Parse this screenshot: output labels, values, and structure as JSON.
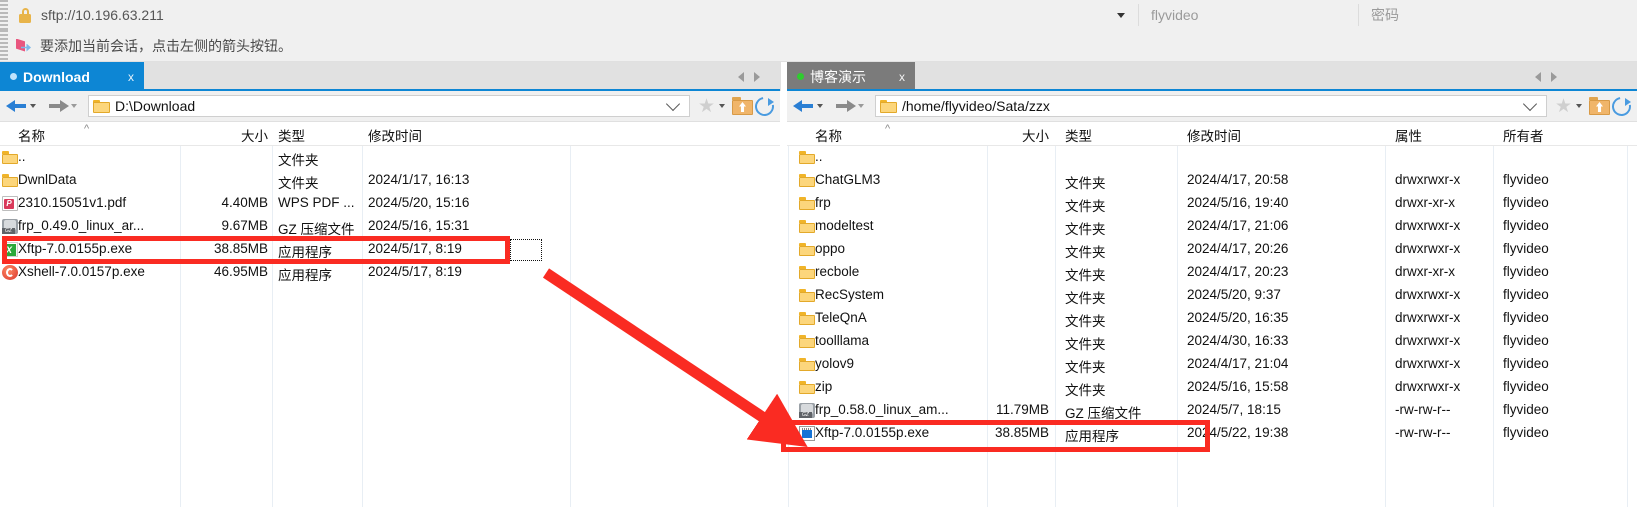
{
  "topbar": {
    "lock_icon": "lock-icon",
    "address": "sftp://10.196.63.211",
    "dropdown_icon": "chevron-down-icon",
    "username": "flyvideo",
    "password_placeholder": "密码"
  },
  "notice": {
    "icon": "flag-arrow-icon",
    "text": "要添加当前会话，点击左侧的箭头按钮。"
  },
  "tabs": {
    "left": {
      "label": "Download",
      "close_label": "x",
      "status_dot": "#bfe3fb"
    },
    "right": {
      "label": "博客演示",
      "close_label": "x",
      "status_dot": "#2ecc2e"
    },
    "nav_prev_icon": "chevron-left-icon",
    "nav_next_icon": "chevron-right-icon"
  },
  "left_pane": {
    "back_icon": "back-arrow-icon",
    "forward_icon": "forward-arrow-icon",
    "path": "D:\\Download",
    "path_dropdown_icon": "chevron-down-icon",
    "star_icon": "star-icon",
    "star_dropdown_icon": "chevron-down-icon",
    "up_folder_icon": "up-folder-icon",
    "refresh_icon": "refresh-icon",
    "columns": [
      "名称",
      "大小",
      "类型",
      "修改时间"
    ],
    "sort_indicator": "^",
    "rows": [
      {
        "icon": "folder-icon",
        "name": "..",
        "size": "",
        "type": "文件夹",
        "modified": ""
      },
      {
        "icon": "folder-icon",
        "name": "DwnlData",
        "size": "",
        "type": "文件夹",
        "modified": "2024/1/17, 16:13"
      },
      {
        "icon": "pdf-icon",
        "name": "2310.15051v1.pdf",
        "size": "4.40MB",
        "type": "WPS PDF ...",
        "modified": "2024/5/20, 15:16"
      },
      {
        "icon": "gz-icon",
        "name": "frp_0.49.0_linux_ar...",
        "size": "9.67MB",
        "type": "GZ 压缩文件",
        "modified": "2024/5/16, 15:31"
      },
      {
        "icon": "xftp-icon",
        "name": "Xftp-7.0.0155p.exe",
        "size": "38.85MB",
        "type": "应用程序",
        "modified": "2024/5/17, 8:19"
      },
      {
        "icon": "xshell-icon",
        "name": "Xshell-7.0.0157p.exe",
        "size": "46.95MB",
        "type": "应用程序",
        "modified": "2024/5/17, 8:19"
      }
    ],
    "highlighted_row_index": 4
  },
  "right_pane": {
    "back_icon": "back-arrow-icon",
    "forward_icon": "forward-arrow-icon",
    "path": "/home/flyvideo/Sata/zzx",
    "path_dropdown_icon": "chevron-down-icon",
    "star_icon": "star-icon",
    "star_dropdown_icon": "chevron-down-icon",
    "up_folder_icon": "up-folder-icon",
    "refresh_icon": "refresh-icon",
    "columns": [
      "名称",
      "大小",
      "类型",
      "修改时间",
      "属性",
      "所有者"
    ],
    "sort_indicator": "^",
    "rows": [
      {
        "icon": "folder-icon",
        "name": "..",
        "size": "",
        "type": "",
        "modified": "",
        "attrs": "",
        "owner": ""
      },
      {
        "icon": "folder-icon",
        "name": "ChatGLM3",
        "size": "",
        "type": "文件夹",
        "modified": "2024/4/17, 20:58",
        "attrs": "drwxrwxr-x",
        "owner": "flyvideo"
      },
      {
        "icon": "folder-icon",
        "name": "frp",
        "size": "",
        "type": "文件夹",
        "modified": "2024/5/16, 19:40",
        "attrs": "drwxr-xr-x",
        "owner": "flyvideo"
      },
      {
        "icon": "folder-icon",
        "name": "modeltest",
        "size": "",
        "type": "文件夹",
        "modified": "2024/4/17, 21:06",
        "attrs": "drwxrwxr-x",
        "owner": "flyvideo"
      },
      {
        "icon": "folder-icon",
        "name": "oppo",
        "size": "",
        "type": "文件夹",
        "modified": "2024/4/17, 20:26",
        "attrs": "drwxrwxr-x",
        "owner": "flyvideo"
      },
      {
        "icon": "folder-icon",
        "name": "recbole",
        "size": "",
        "type": "文件夹",
        "modified": "2024/4/17, 20:23",
        "attrs": "drwxr-xr-x",
        "owner": "flyvideo"
      },
      {
        "icon": "folder-icon",
        "name": "RecSystem",
        "size": "",
        "type": "文件夹",
        "modified": "2024/5/20, 9:37",
        "attrs": "drwxrwxr-x",
        "owner": "flyvideo"
      },
      {
        "icon": "folder-icon",
        "name": "TeleQnA",
        "size": "",
        "type": "文件夹",
        "modified": "2024/5/20, 16:35",
        "attrs": "drwxrwxr-x",
        "owner": "flyvideo"
      },
      {
        "icon": "folder-icon",
        "name": "toolllama",
        "size": "",
        "type": "文件夹",
        "modified": "2024/4/30, 16:33",
        "attrs": "drwxrwxr-x",
        "owner": "flyvideo"
      },
      {
        "icon": "folder-icon",
        "name": "yolov9",
        "size": "",
        "type": "文件夹",
        "modified": "2024/4/17, 21:04",
        "attrs": "drwxrwxr-x",
        "owner": "flyvideo"
      },
      {
        "icon": "folder-icon",
        "name": "zip",
        "size": "",
        "type": "文件夹",
        "modified": "2024/5/16, 15:58",
        "attrs": "drwxrwxr-x",
        "owner": "flyvideo"
      },
      {
        "icon": "gz-icon",
        "name": "frp_0.58.0_linux_am...",
        "size": "11.79MB",
        "type": "GZ 压缩文件",
        "modified": "2024/5/7, 18:15",
        "attrs": "-rw-rw-r--",
        "owner": "flyvideo"
      },
      {
        "icon": "xftp-blue-icon",
        "name": "Xftp-7.0.0155p.exe",
        "size": "38.85MB",
        "type": "应用程序",
        "modified": "2024/5/22, 19:38",
        "attrs": "-rw-rw-r--",
        "owner": "flyvideo"
      }
    ],
    "highlighted_row_index": 12
  },
  "annotations": {
    "highlight_color": "#fa2b22",
    "arrow_from": "left-pane-xftp-row",
    "arrow_to": "right-pane-xftp-row",
    "selection_box": "dotted-selection-box"
  }
}
